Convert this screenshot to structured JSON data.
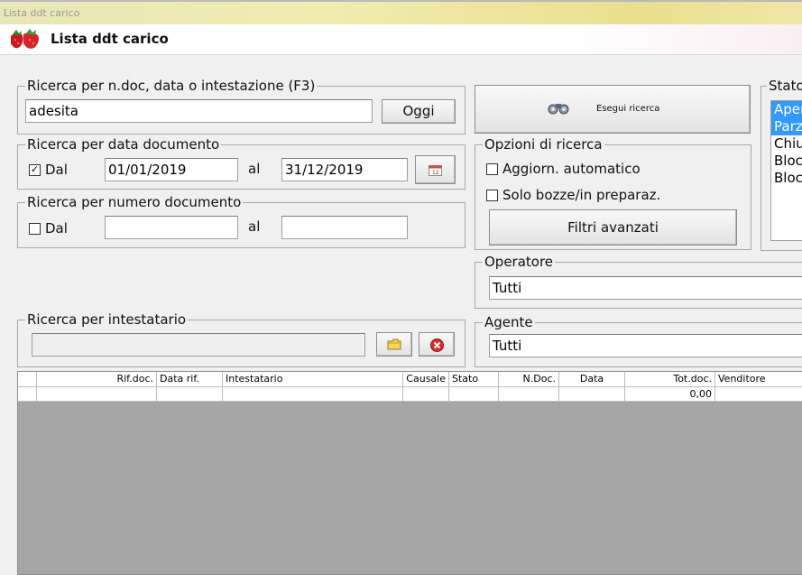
{
  "window": {
    "caption": "Lista ddt carico",
    "title": "Lista ddt carico"
  },
  "search_text": {
    "legend": "Ricerca per n.doc, data o intestazione (F3)",
    "value": "adesita",
    "today_button": "Oggi"
  },
  "run_search": {
    "label": "Esegui ricerca"
  },
  "status": {
    "legend": "Stato",
    "items": [
      "Aper",
      "Parz",
      "Chiu",
      "Bloc",
      "Bloc"
    ],
    "selected": [
      0,
      1
    ]
  },
  "date_search": {
    "legend": "Ricerca per data documento",
    "checkbox_checked": true,
    "from_label": "Dal",
    "from_value": "01/01/2019",
    "to_label": "al",
    "to_value": "31/12/2019"
  },
  "number_search": {
    "legend": "Ricerca per numero documento",
    "checkbox_checked": false,
    "from_label": "Dal",
    "from_value": "",
    "to_label": "al",
    "to_value": ""
  },
  "options": {
    "legend": "Opzioni di ricerca",
    "auto_update_label": "Aggiorn. automatico",
    "drafts_label": "Solo bozze/in preparaz.",
    "advanced_filters": "Filtri avanzati"
  },
  "operator": {
    "legend": "Operatore",
    "value": "Tutti"
  },
  "holder": {
    "legend": "Ricerca per intestatario",
    "value": ""
  },
  "agent": {
    "legend": "Agente",
    "value": "Tutti"
  },
  "grid": {
    "columns": [
      "",
      "Rif.doc.",
      "Data rif.",
      "Intestatario",
      "Causale",
      "Stato",
      "N.Doc.",
      "Data",
      "Tot.doc.",
      "Venditore"
    ],
    "rows": [
      [
        "",
        "",
        "",
        "",
        "",
        "",
        "",
        "",
        "0,00",
        ""
      ]
    ]
  },
  "colors": {
    "selection": "#3399ff",
    "grid_bg": "#a6a6a6"
  }
}
